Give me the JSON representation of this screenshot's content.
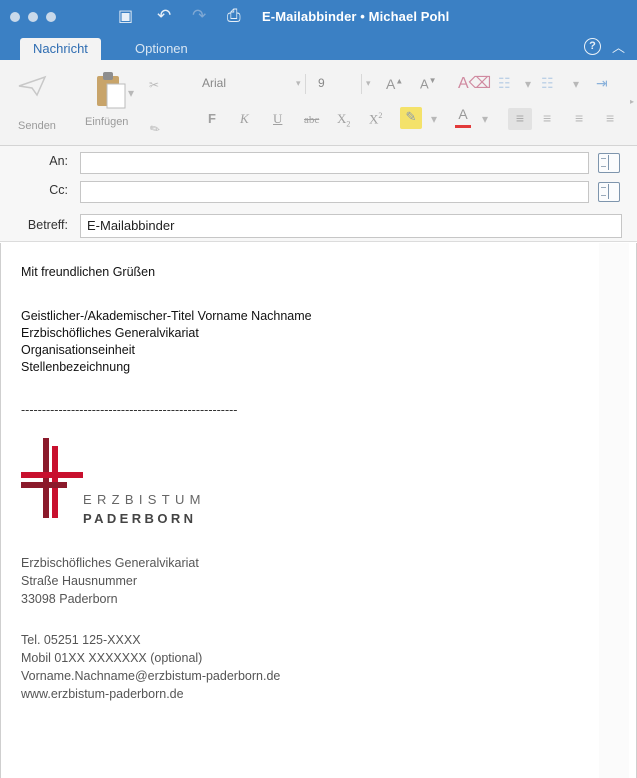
{
  "window": {
    "title": "E-Mailabbinder • Michael Pohl"
  },
  "tabs": [
    {
      "label": "Nachricht"
    },
    {
      "label": "Optionen"
    }
  ],
  "help_glyph": "?",
  "ribbon": {
    "send_label": "Senden",
    "paste_label": "Einfügen",
    "font_name": "Arial",
    "font_size": "9",
    "format_labels": {
      "bold": "F",
      "italic": "K",
      "underline": "U",
      "strike": "abc",
      "subscript": "X",
      "sub_mark": "2",
      "superscript": "X",
      "sup_mark": "2",
      "font_color": "A",
      "grow": "A",
      "shrink": "A"
    }
  },
  "fields": {
    "to_label": "An:",
    "to_value": "",
    "cc_label": "Cc:",
    "cc_value": "",
    "subject_label": "Betreff:",
    "subject_value": "E-Mailabbinder"
  },
  "body": {
    "greeting": "Mit freundlichen Grüßen",
    "signature_lines": [
      "Geistlicher-/Akademischer-Titel Vorname Nachname",
      "Erzbischöfliches Generalvikariat",
      "Organisationseinheit",
      "Stellenbezeichnung"
    ],
    "separator": "----------------------------------------------------",
    "logo": {
      "line1": "ERZBISTUM",
      "line2": "PADERBORN"
    },
    "address_lines": [
      "Erzbischöfliches Generalvikariat",
      "Straße Hausnummer",
      "33098 Paderborn"
    ],
    "contact_lines": [
      "Tel. 05251 125-XXXX",
      "Mobil 01XX XXXXXXX (optional)",
      "Vorname.Nachname@erzbistum-paderborn.de",
      "www.erzbistum-paderborn.de"
    ]
  },
  "colors": {
    "title_bar": "#3b80c4",
    "accent": "#2f6db2",
    "logo_red": "#c8102e",
    "logo_dark_red": "#8b1a2b"
  },
  "icons": [
    "save-icon",
    "undo-icon",
    "redo-icon",
    "attach-icon",
    "help-icon",
    "collapse-icon",
    "address-book-icon",
    "paste-icon",
    "format-painter-icon"
  ]
}
